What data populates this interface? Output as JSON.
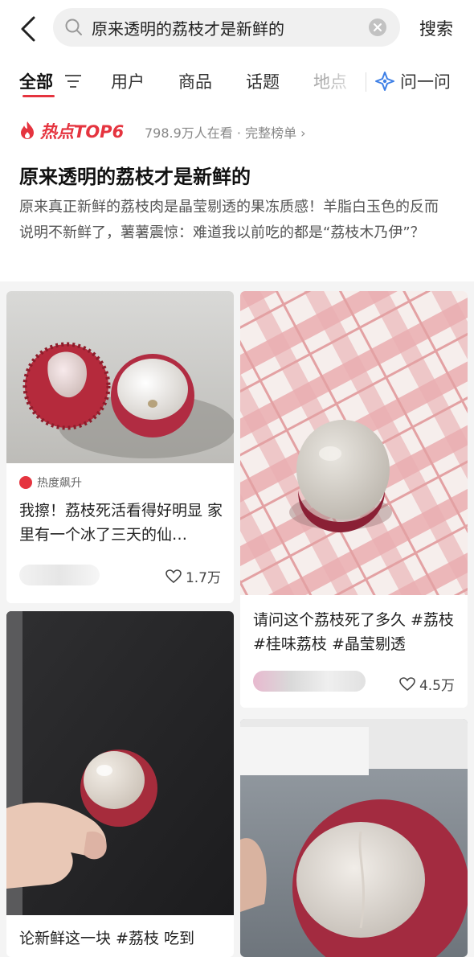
{
  "search": {
    "query": "原来透明的荔枝才是新鲜的",
    "button_label": "搜索"
  },
  "tabs": [
    {
      "label": "全部"
    },
    {
      "label": "用户"
    },
    {
      "label": "商品"
    },
    {
      "label": "话题"
    },
    {
      "label": "地点"
    },
    {
      "label": "问一问"
    }
  ],
  "hot": {
    "title": "热点TOP6",
    "meta": "798.9万人在看 · 完整榜单 ›",
    "headline": "原来透明的荔枝才是新鲜的",
    "description": "原来真正新鲜的荔枝肉是晶莹剔透的果冻质感！羊脂白玉色的反而说明不新鲜了，薯薯震惊：难道我以前吃的都是“荔枝木乃伊”？"
  },
  "cards": [
    {
      "badge": "热度飙升",
      "title": "我擦！荔枝死活看得好明显 家里有一个冰了三天的仙…",
      "likes": "1.7万"
    },
    {
      "title": "请问这个荔枝死了多久 #荔枝 #桂味荔枝 #晶莹剔透",
      "likes": "4.5万"
    },
    {
      "title": "论新鲜这一块 #荔枝 吃到"
    },
    {
      "title": ""
    }
  ],
  "colors": {
    "accent": "#e5343f",
    "ask_icon": "#3d7fe6"
  }
}
